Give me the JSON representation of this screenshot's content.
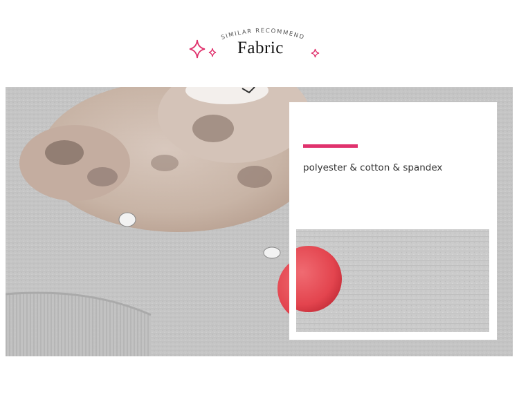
{
  "header": {
    "subtitle": "SIMILAR  RECOMMEND",
    "title": "Fabric"
  },
  "fabric": {
    "description": "polyester & cotton & spandex"
  },
  "icons": [
    "sparkle-icon",
    "sparkle-icon",
    "sparkle-icon"
  ],
  "colors": {
    "accent": "#e0326d",
    "background": "#ffffff",
    "fabric_gray": "#c9c9c9",
    "pompom_red": "#e9505a"
  }
}
